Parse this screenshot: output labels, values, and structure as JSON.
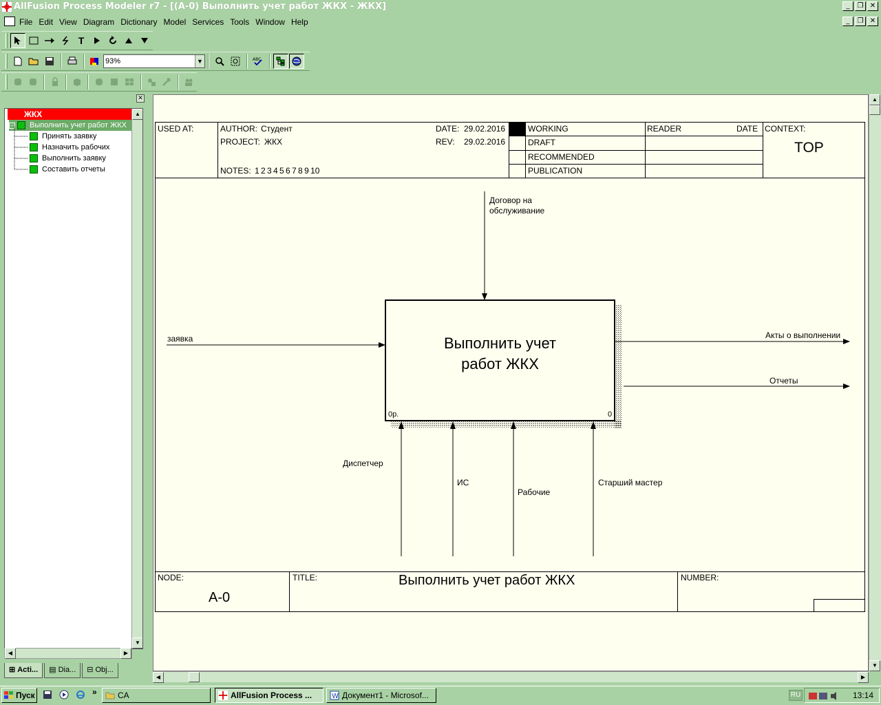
{
  "window": {
    "title": "AllFusion Process Modeler r7 - [(A-0) Выполнить учет работ ЖКХ - ЖКХ]",
    "controls": [
      "_",
      "❐",
      "✕"
    ]
  },
  "menu": [
    "File",
    "Edit",
    "View",
    "Diagram",
    "Dictionary",
    "Model",
    "Services",
    "Tools",
    "Window",
    "Help"
  ],
  "toolbar": {
    "zoom_value": "93%"
  },
  "explorer": {
    "root": "ЖКХ",
    "activity": "Выполнить учет работ ЖКХ",
    "children": [
      "Принять заявку",
      "Назначить рабочих",
      "Выполнить заявку",
      "Составить отчеты"
    ],
    "tabs": [
      "Acti...",
      "Dia...",
      "Obj..."
    ]
  },
  "header": {
    "used_at_label": "USED AT:",
    "author_label": "AUTHOR:",
    "author": "Студент",
    "project_label": "PROJECT:",
    "project": "ЖКХ",
    "date_label": "DATE:",
    "date": "29.02.2016",
    "rev_label": "REV:",
    "rev": "29.02.2016",
    "notes_label": "NOTES:",
    "notes": "1  2  3  4  5  6  7  8  9  10",
    "status": [
      "WORKING",
      "DRAFT",
      "RECOMMENDED",
      "PUBLICATION"
    ],
    "reader_label": "READER",
    "reader_date_label": "DATE",
    "context_label": "CONTEXT:",
    "context_value": "TOP"
  },
  "diagram": {
    "activity_title_line1": "Выполнить учет",
    "activity_title_line2": "работ ЖКХ",
    "activity_cost": "0р.",
    "activity_number": "0",
    "control": "Договор на обслуживание",
    "control_line1": "Договор на",
    "control_line2": "обслуживание",
    "input": "заявка",
    "outputs": [
      "Акты о выполнении",
      "Отчеты"
    ],
    "mechanisms": [
      "Диспетчер",
      "ИС",
      "Рабочие",
      "Старший мастер"
    ]
  },
  "footer": {
    "node_label": "NODE:",
    "node": "A-0",
    "title_label": "TITLE:",
    "title": "Выполнить учет работ ЖКХ",
    "number_label": "NUMBER:"
  },
  "taskbar": {
    "start": "Пуск",
    "quick_more": "»",
    "folder": "CA",
    "tasks": [
      "AllFusion Process ...",
      "Документ1 - Microsof..."
    ],
    "lang": "RU",
    "clock": "13:14"
  },
  "colors": {
    "chrome": "#a9d2a4",
    "canvas": "#fffff0",
    "tree_root": "#ff0000",
    "tree_node": "#0dbf0d"
  }
}
